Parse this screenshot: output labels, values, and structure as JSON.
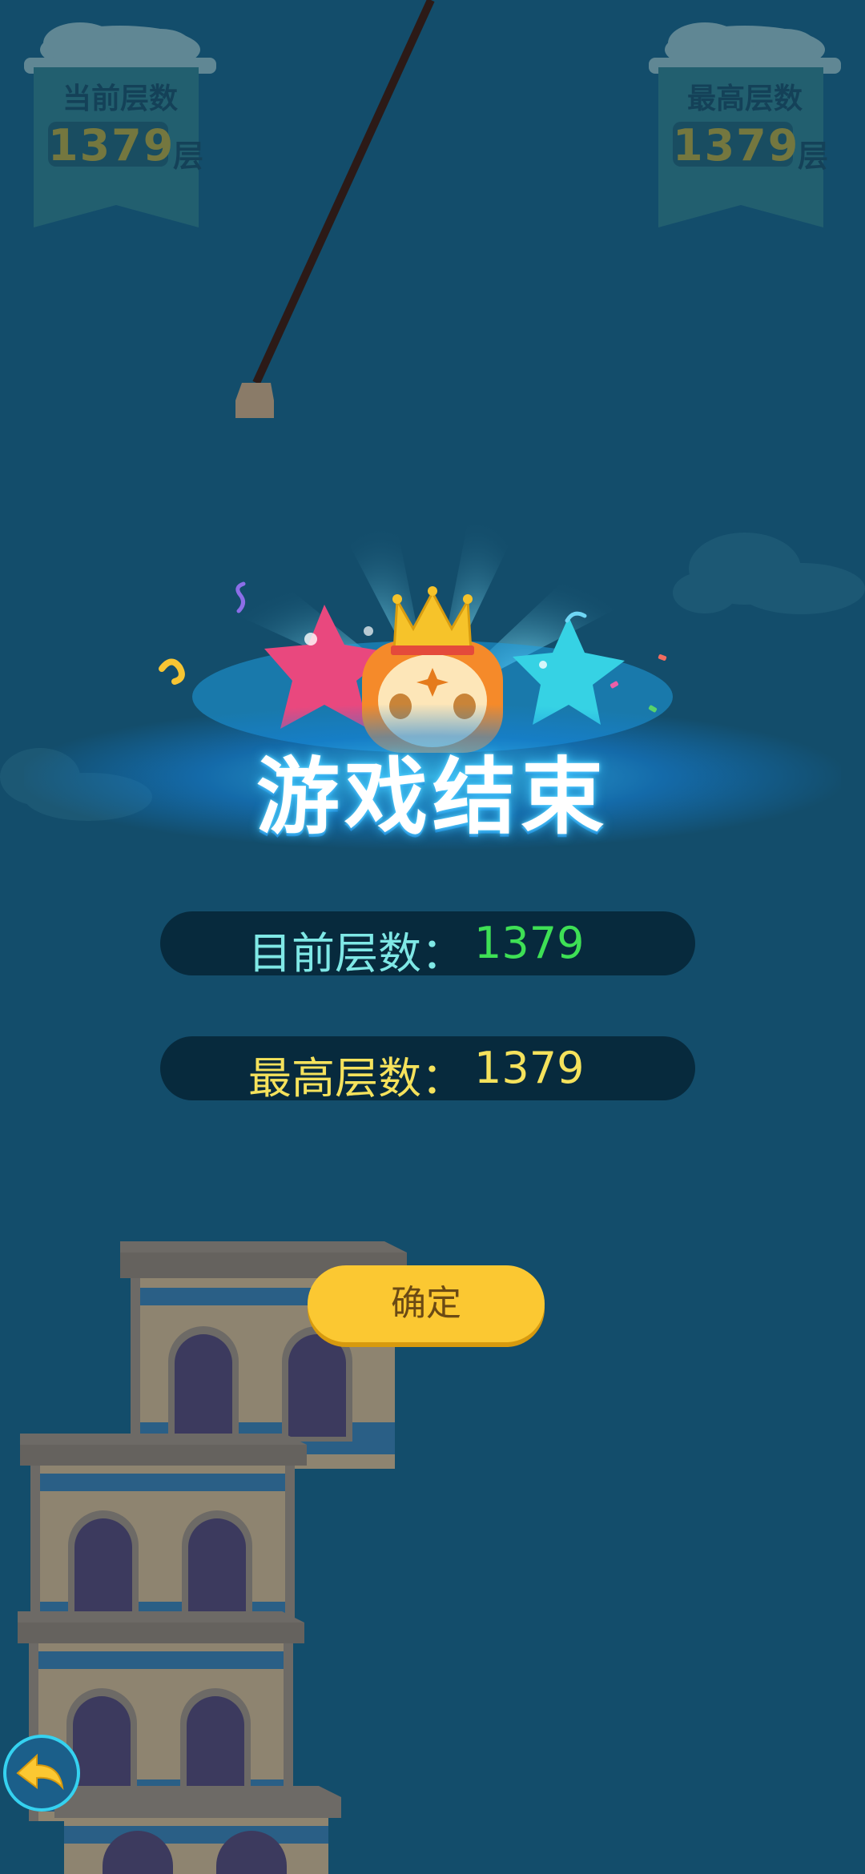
{
  "current_banner": {
    "title": "当前层数",
    "value": "1379",
    "unit": "层"
  },
  "best_banner": {
    "title": "最高层数",
    "value": "1379",
    "unit": "层"
  },
  "game_over": {
    "title": "游戏结束",
    "current_label": "目前层数：",
    "current_value": "1379",
    "best_label": "最高层数：",
    "best_value": "1379",
    "confirm_label": "确定"
  },
  "colors": {
    "background": "#134d6b",
    "current_value": "#3ee055",
    "best_value": "#f5e25c",
    "current_label": "#7fe8e6",
    "best_label": "#f5e25c",
    "button": "#fbc832"
  },
  "icons": {
    "back": "back-arrow-icon",
    "crown": "crown-icon",
    "mascot": "mascot-icon"
  }
}
